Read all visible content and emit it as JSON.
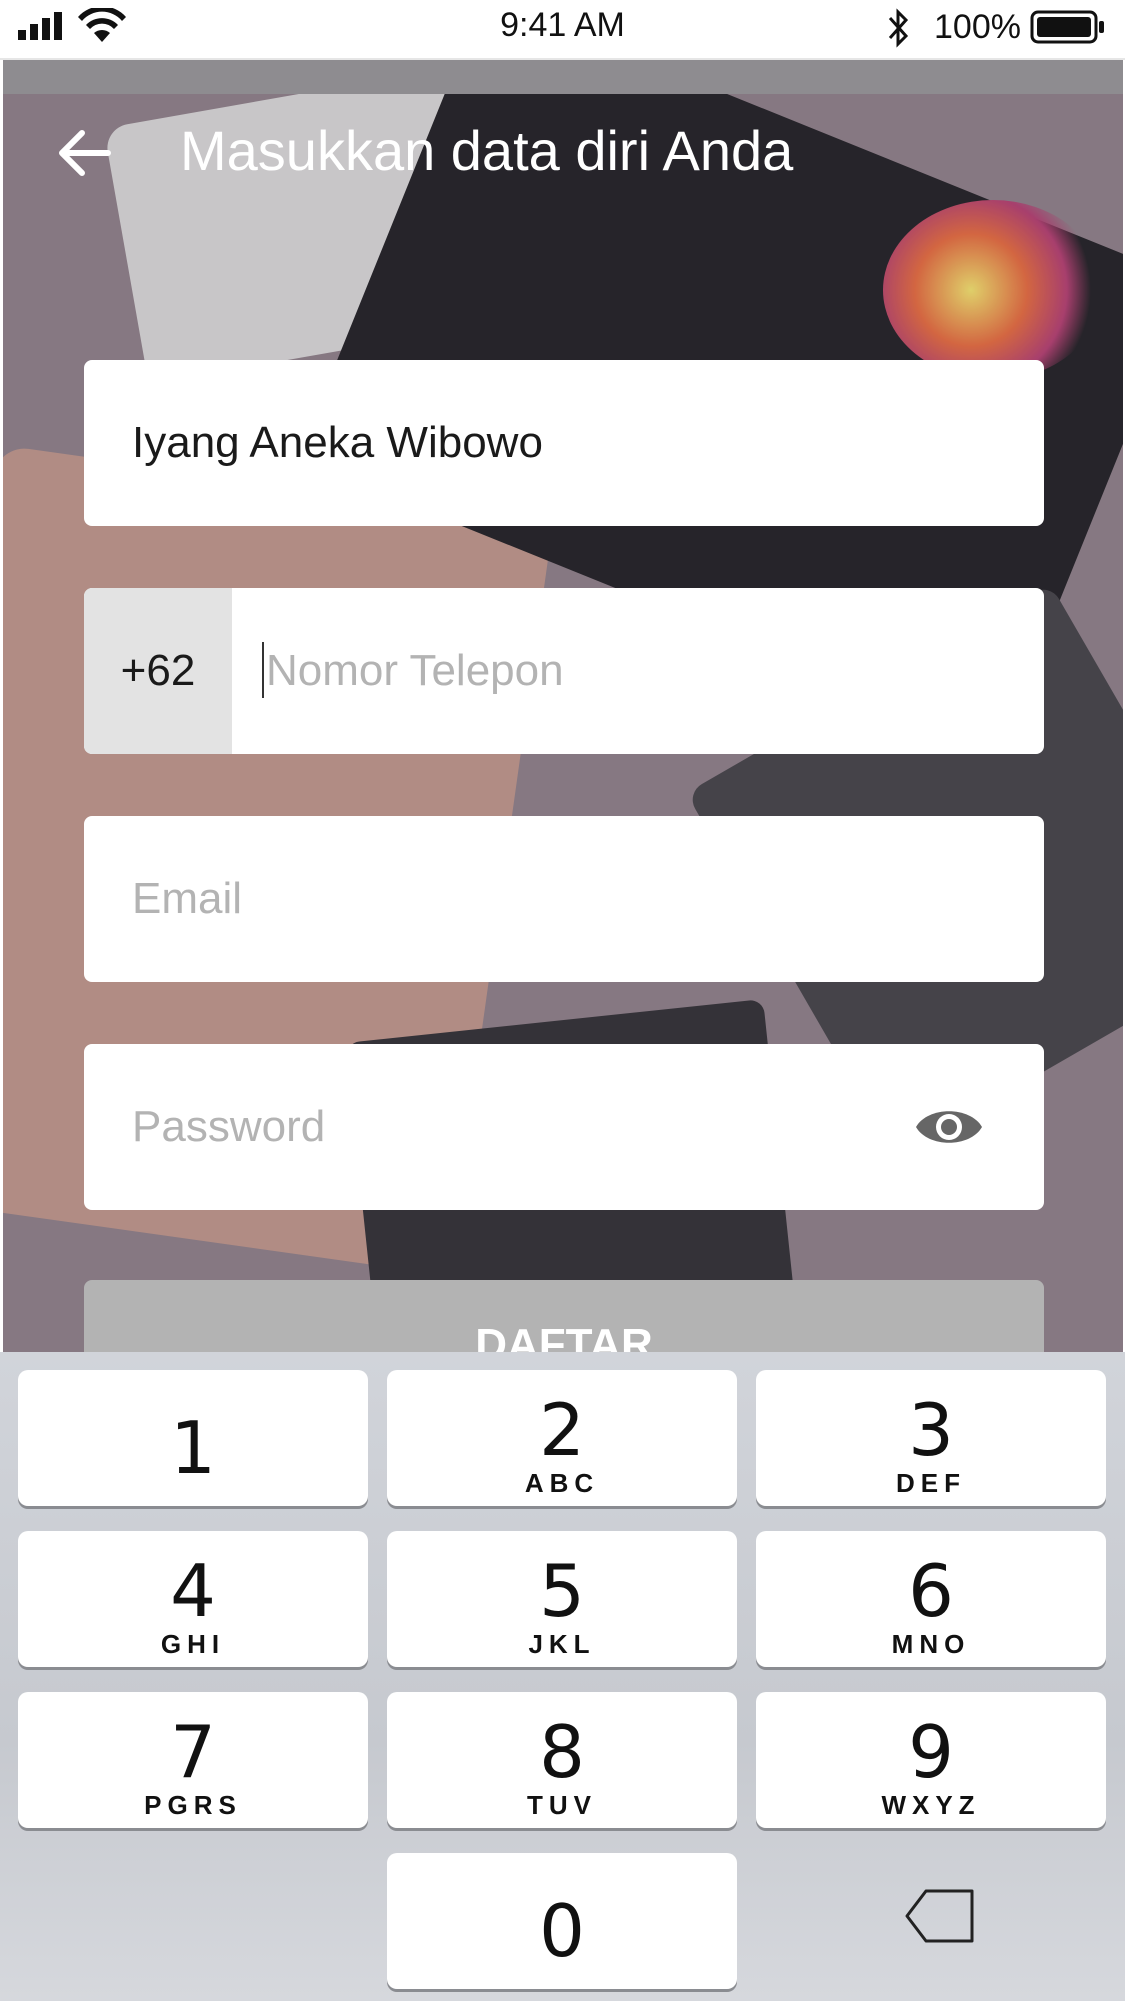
{
  "status_bar": {
    "time": "9:41 AM",
    "battery_pct": "100%"
  },
  "header": {
    "title": "Masukkan data diri Anda"
  },
  "form": {
    "name_value": "Iyang Aneka Wibowo",
    "phone_prefix": "+62",
    "phone_placeholder": "Nomor Telepon",
    "email_placeholder": "Email",
    "password_placeholder": "Password",
    "submit_label": "DAFTAR"
  },
  "keypad": {
    "keys": [
      {
        "num": "1",
        "letters": ""
      },
      {
        "num": "2",
        "letters": "ABC"
      },
      {
        "num": "3",
        "letters": "DEF"
      },
      {
        "num": "4",
        "letters": "GHI"
      },
      {
        "num": "5",
        "letters": "JKL"
      },
      {
        "num": "6",
        "letters": "MNO"
      },
      {
        "num": "7",
        "letters": "PGRS"
      },
      {
        "num": "8",
        "letters": "TUV"
      },
      {
        "num": "9",
        "letters": "WXYZ"
      },
      {
        "num": "0",
        "letters": ""
      }
    ]
  },
  "icons": [
    "signal-icon",
    "wifi-icon",
    "bluetooth-icon",
    "battery-icon",
    "back-arrow-icon",
    "eye-icon",
    "delete-icon"
  ]
}
